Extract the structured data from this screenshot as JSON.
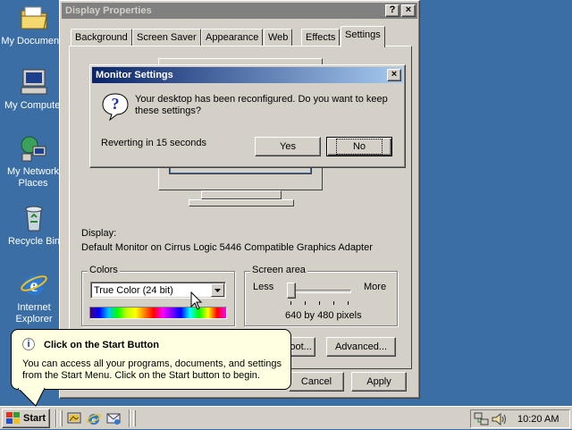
{
  "desktop": {
    "icons": [
      {
        "label": "My Documents"
      },
      {
        "label": "My Computer"
      },
      {
        "label": "My Network Places"
      },
      {
        "label": "Recycle Bin"
      },
      {
        "label": "Internet Explorer"
      }
    ]
  },
  "display_properties": {
    "title": "Display Properties",
    "help_glyph": "?",
    "close_glyph": "×",
    "tabs": [
      "Background",
      "Screen Saver",
      "Appearance",
      "Web",
      "Effects",
      "Settings"
    ],
    "active_tab": "Settings",
    "display_label": "Display:",
    "display_value": "Default Monitor on Cirrus Logic 5446 Compatible Graphics Adapter",
    "colors_label": "Colors",
    "colors_value": "True Color (24 bit)",
    "screen_area_label": "Screen area",
    "less_label": "Less",
    "more_label": "More",
    "resolution": "640 by 480 pixels",
    "troubleshoot_label": "...oot...",
    "advanced_label": "Advanced...",
    "cancel_label": "Cancel",
    "apply_label": "Apply",
    "colors": {
      "accent_active": "#0a246a",
      "face": "#d4d0c8"
    }
  },
  "monitor_settings": {
    "title": "Monitor Settings",
    "close_glyph": "×",
    "message": "Your desktop has been reconfigured.  Do you want to keep these settings?",
    "countdown": "Reverting in 15 seconds",
    "yes_label": "Yes",
    "no_label": "No",
    "icon_glyph": "?"
  },
  "balloon": {
    "icon_glyph": "i",
    "title": "Click on the Start Button",
    "body": "You can access all your programs, documents, and settings from the Start Menu. Click on the Start button to begin."
  },
  "taskbar": {
    "start_label": "Start",
    "clock": "10:20 AM"
  }
}
